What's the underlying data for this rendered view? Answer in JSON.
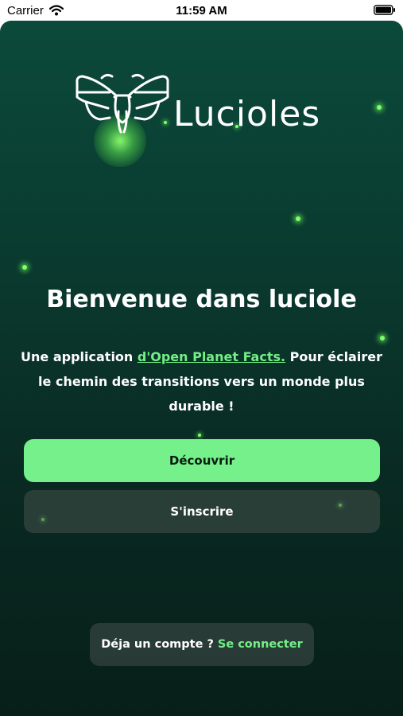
{
  "status_bar": {
    "carrier": "Carrier",
    "time": "11:59 AM"
  },
  "logo": {
    "name": "Lucioles"
  },
  "welcome": {
    "title": "Bienvenue dans luciole",
    "intro_prefix": "Une application ",
    "intro_link": "d'Open Planet Facts.",
    "intro_after_link": " Pour éclairer",
    "intro_line2": "le chemin des transitions vers un monde plus",
    "intro_line3": "durable !"
  },
  "actions": {
    "discover_label": "Découvrir",
    "signup_label": "S'inscrire"
  },
  "login": {
    "prompt": "Déja un compte ?",
    "link_label": "Se connecter"
  },
  "colors": {
    "background_top": "#0b4a3b",
    "background_bottom": "#071f19",
    "accent_green": "#75f08b",
    "firefly_glow": "#7dff6a"
  }
}
